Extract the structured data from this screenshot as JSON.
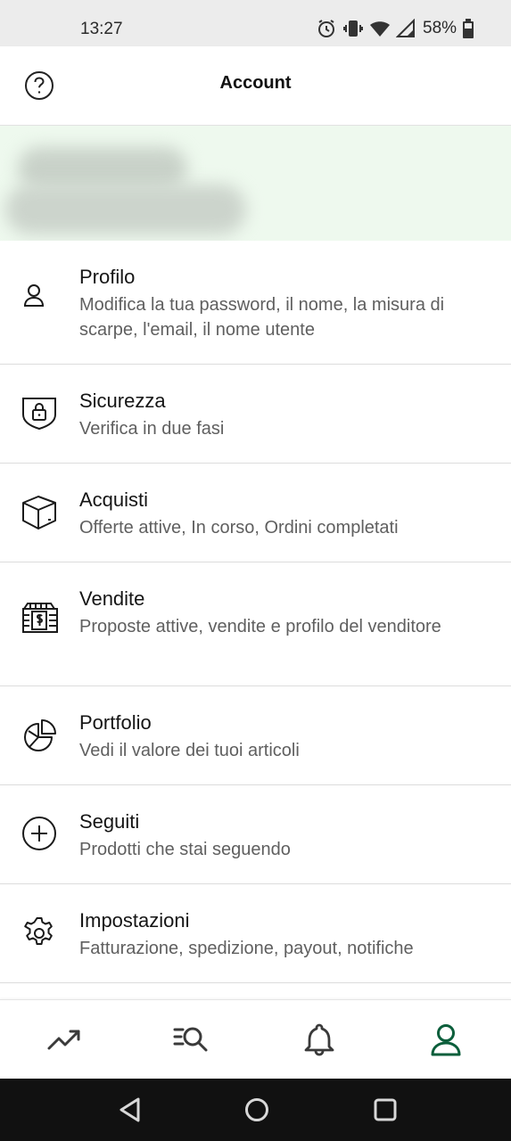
{
  "status_bar": {
    "time": "13:27",
    "battery": "58%",
    "icons": [
      "alarm-icon",
      "vibrate-icon",
      "wifi-icon",
      "signal-icon",
      "battery-icon"
    ]
  },
  "header": {
    "title": "Account",
    "help_icon": "help-icon"
  },
  "colors": {
    "accent": "#0b5e3b",
    "banner_bg": "#eef9ee",
    "text_primary": "#151515",
    "text_secondary": "#5f5f5f"
  },
  "menu": {
    "items": [
      {
        "icon": "user-icon",
        "title": "Profilo",
        "desc": "Modifica la tua password, il nome, la misura di scarpe, l'email, il nome utente"
      },
      {
        "icon": "shield-lock-icon",
        "title": "Sicurezza",
        "desc": "Verifica in due fasi"
      },
      {
        "icon": "package-icon",
        "title": "Acquisti",
        "desc": "Offerte attive, In corso, Ordini completati"
      },
      {
        "icon": "cash-register-icon",
        "title": "Vendite",
        "desc": "Proposte attive, vendite e profilo del venditore"
      },
      {
        "icon": "pie-chart-icon",
        "title": "Portfolio",
        "desc": "Vedi il valore dei tuoi articoli"
      },
      {
        "icon": "plus-circle-icon",
        "title": "Seguiti",
        "desc": "Prodotti che stai seguendo"
      },
      {
        "icon": "gear-icon",
        "title": "Impostazioni",
        "desc": "Fatturazione, spedizione, payout, notifiche"
      }
    ]
  },
  "bottom_nav": {
    "items": [
      {
        "icon": "trending-icon",
        "active": false
      },
      {
        "icon": "search-list-icon",
        "active": false
      },
      {
        "icon": "bell-icon",
        "active": false
      },
      {
        "icon": "account-icon",
        "active": true
      }
    ]
  }
}
